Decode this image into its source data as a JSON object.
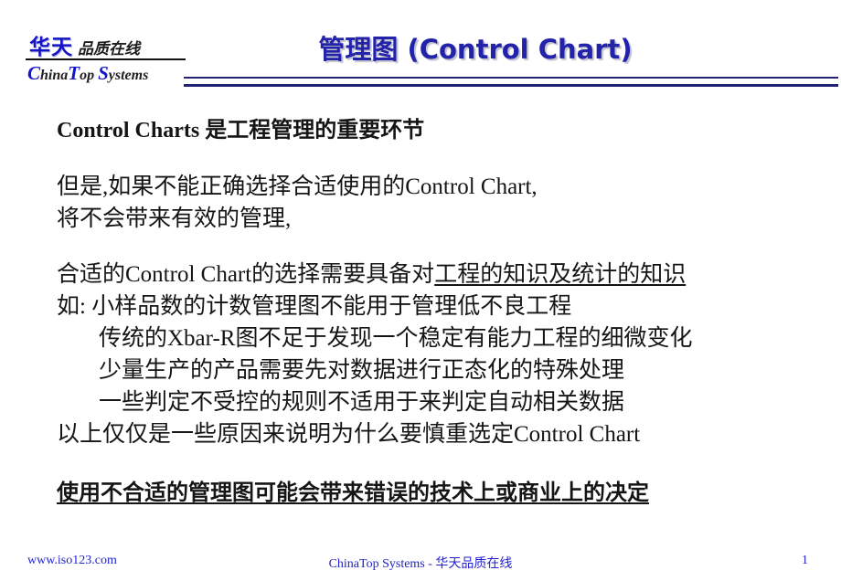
{
  "header": {
    "logo": {
      "cn_main": "华天",
      "cn_sub": "品质在线",
      "en_c": "C",
      "en_hina": "hina",
      "en_t": "T",
      "en_op": "op",
      "en_s": "S",
      "en_ystems": "ystems",
      "en_full": "ChinaTop Systems"
    },
    "title": "管理图 (Control Chart)",
    "rule_color": "#232373"
  },
  "body": {
    "heading": "Control Charts 是工程管理的重要环节",
    "para2": [
      "但是,如果不能正确选择合适使用的Control Chart,",
      "将不会带来有效的管理,"
    ],
    "para3_line1_plain": "合适的Control Chart的选择需要具备对",
    "para3_line1_underlined": "工程的知识及统计的知识",
    "para3_lines": [
      "如: 小样品数的计数管理图不能用于管理低不良工程",
      "传统的Xbar-R图不足于发现一个稳定有能力工程的细微变化",
      "少量生产的产品需要先对数据进行正态化的特殊处理",
      "一些判定不受控的规则不适用于来判定自动相关数据",
      "以上仅仅是一些原因来说明为什么要慎重选定Control Chart"
    ],
    "conclusion": "使用不合适的管理图可能会带来错误的技术上或商业上的决定"
  },
  "footer": {
    "left": "www.iso123.com",
    "center": "ChinaTop Systems - 华天品质在线",
    "page_number": "1",
    "color": "#2222cc"
  }
}
